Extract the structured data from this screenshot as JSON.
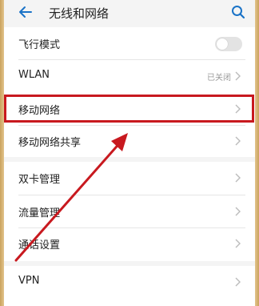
{
  "header": {
    "title": "无线和网络",
    "back_icon": "back-arrow-icon",
    "search_icon": "search-icon"
  },
  "rows": {
    "airplane": {
      "label": "飞行模式",
      "toggle_on": false
    },
    "wlan": {
      "label": "WLAN",
      "value": "已关闭"
    },
    "mobile_network": {
      "label": "移动网络"
    },
    "mobile_sharing": {
      "label": "移动网络共享"
    },
    "dual_sim": {
      "label": "双卡管理"
    },
    "data_usage": {
      "label": "流量管理"
    },
    "call_settings": {
      "label": "通话设置"
    },
    "vpn": {
      "label": "VPN"
    }
  },
  "colors": {
    "accent": "#1a73c7",
    "highlight": "#c8191f"
  }
}
